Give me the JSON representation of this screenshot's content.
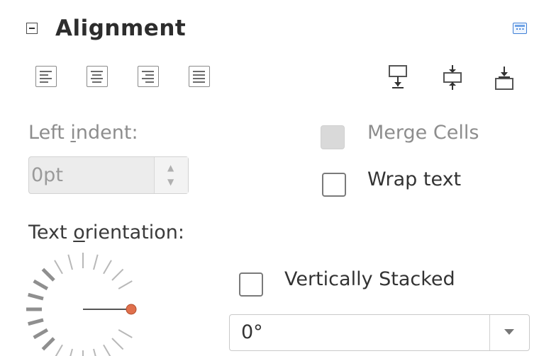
{
  "panel": {
    "title": "Alignment"
  },
  "horizontal_align": [
    {
      "name": "align-left",
      "icon": "align-left-icon"
    },
    {
      "name": "align-center",
      "icon": "align-center-icon"
    },
    {
      "name": "align-right",
      "icon": "align-right-icon"
    },
    {
      "name": "align-justify",
      "icon": "align-justify-icon"
    }
  ],
  "vertical_align": [
    {
      "name": "align-top",
      "icon": "align-top-icon"
    },
    {
      "name": "align-middle",
      "icon": "align-middle-icon"
    },
    {
      "name": "align-bottom",
      "icon": "align-bottom-icon"
    }
  ],
  "left_indent": {
    "label_pre": "Left ",
    "label_mnemonic": "i",
    "label_post": "ndent:",
    "value": "0pt"
  },
  "merge_cells": {
    "label": "Merge Cells",
    "checked": false,
    "disabled": true
  },
  "wrap_text": {
    "label": "Wrap text",
    "checked": false
  },
  "text_orientation": {
    "label_pre": "Text ",
    "label_mnemonic": "o",
    "label_post": "rientation:",
    "angle_degrees": 0,
    "value": "0°"
  },
  "vertically_stacked": {
    "label": "Vertically Stacked",
    "checked": false
  },
  "colors": {
    "accent": "#3f7fd6",
    "dial_knob": "#e0704c",
    "disabled_text": "#8d8d8d"
  }
}
